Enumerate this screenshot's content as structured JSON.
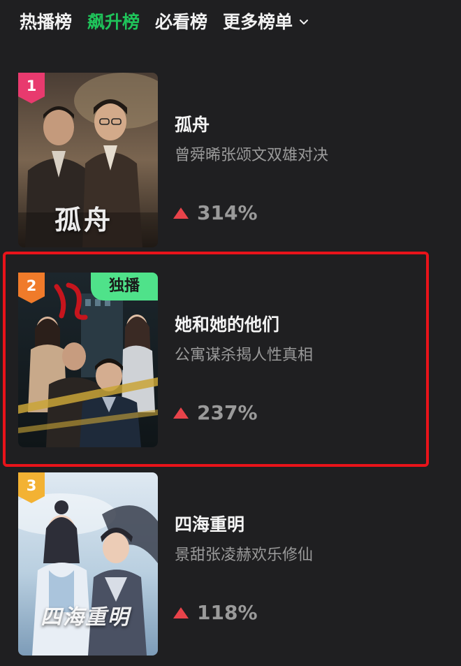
{
  "tabs": [
    {
      "label": "热播榜",
      "active": false
    },
    {
      "label": "飙升榜",
      "active": true
    },
    {
      "label": "必看榜",
      "active": false
    },
    {
      "label": "更多榜单",
      "active": false,
      "dropdown": true
    }
  ],
  "colors": {
    "active_tab": "#1fc35a",
    "background": "#1f1f21",
    "trend_up": "#e8434a",
    "highlight": "#e8131a",
    "exclusive_badge": "#4fe28a",
    "rank_1": "#e83a6e",
    "rank_2": "#f07b2a",
    "rank_3": "#f3b233"
  },
  "items": [
    {
      "rank": "1",
      "title": "孤舟",
      "description": "曾舜晞张颂文双雄对决",
      "trend": "314%",
      "poster_text": "孤舟",
      "badge": ""
    },
    {
      "rank": "2",
      "title": "她和她的他们",
      "description": "公寓谋杀揭人性真相",
      "trend": "237%",
      "poster_text": "她",
      "badge": "独播",
      "highlighted": true
    },
    {
      "rank": "3",
      "title": "四海重明",
      "description": "景甜张凌赫欢乐修仙",
      "trend": "118%",
      "poster_text": "四海重明",
      "badge": ""
    }
  ]
}
